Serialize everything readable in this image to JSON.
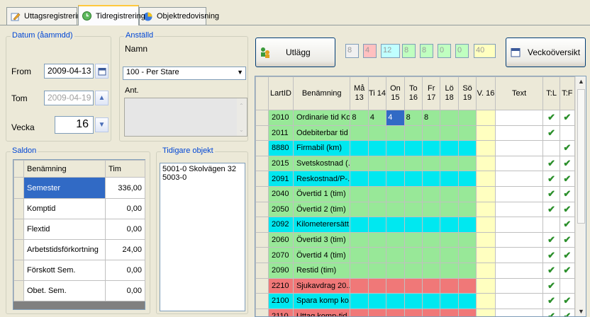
{
  "tabs": [
    {
      "label": "Uttagsregistrering",
      "icon": "pencil-icon"
    },
    {
      "label": "Tidregistrering",
      "icon": "clock-icon"
    },
    {
      "label": "Objektredovisning",
      "icon": "pie-chart-icon"
    }
  ],
  "datum": {
    "legend": "Datum (åammdd)",
    "from_label": "From",
    "from_value": "2009-04-13",
    "tom_label": "Tom",
    "tom_value": "2009-04-19",
    "vecka_label": "Vecka",
    "vecka_value": "16"
  },
  "anstalld": {
    "legend": "Anställd",
    "namn_label": "Namn",
    "namn_value": "100 - Per Stare",
    "ant_label": "Ant."
  },
  "saldon": {
    "legend": "Saldon",
    "headers": [
      "Benämning",
      "Tim"
    ],
    "rows": [
      {
        "name": "Semester",
        "value": "336,00"
      },
      {
        "name": "Komptid",
        "value": "0,00"
      },
      {
        "name": "Flextid",
        "value": "0,00"
      },
      {
        "name": "Arbetstidsförkortning",
        "value": "24,00"
      },
      {
        "name": "Förskott Sem.",
        "value": "0,00"
      },
      {
        "name": "Obet. Sem.",
        "value": "0,00"
      }
    ]
  },
  "tidigare": {
    "legend": "Tidigare objekt",
    "lines": [
      "5001-0  Skolvägen 32",
      "5003-0"
    ]
  },
  "toolbar": {
    "utlagg_label": "Utlägg",
    "totals": [
      "8",
      "4",
      "12",
      "8",
      "8",
      "0",
      "0",
      "40"
    ],
    "veckooversikt_label": "Veckoöversikt"
  },
  "grid": {
    "headers": [
      "LartID",
      "Benämning",
      "Må 13",
      "Ti 14",
      "On 15",
      "To 16",
      "Fr 17",
      "Lö 18",
      "Sö 19",
      "V. 16",
      "Text",
      "T:L",
      "T:F"
    ],
    "rows": [
      {
        "id": "2010",
        "name": "Ordinarie tid Ko...",
        "days": [
          "8",
          "4",
          "4",
          "8",
          "8",
          "",
          ""
        ],
        "tl": true,
        "tf": true,
        "color": "#98e898"
      },
      {
        "id": "2011",
        "name": "Odebiterbar tid ...",
        "days": [
          "",
          "",
          "",
          "",
          "",
          "",
          ""
        ],
        "tl": true,
        "tf": false,
        "color": "#98e898"
      },
      {
        "id": "8880",
        "name": "Firmabil (km)",
        "days": [
          "",
          "",
          "",
          "",
          "",
          "",
          ""
        ],
        "tl": false,
        "tf": true,
        "color": "#00e8f0"
      },
      {
        "id": "2015",
        "name": "Svetskostnad (...",
        "days": [
          "",
          "",
          "",
          "",
          "",
          "",
          ""
        ],
        "tl": true,
        "tf": true,
        "color": "#98e898"
      },
      {
        "id": "2091",
        "name": "Reskostnad/P-...",
        "days": [
          "",
          "",
          "",
          "",
          "",
          "",
          ""
        ],
        "tl": true,
        "tf": true,
        "color": "#00e8f0"
      },
      {
        "id": "2040",
        "name": "Övertid 1 (tim)",
        "days": [
          "",
          "",
          "",
          "",
          "",
          "",
          ""
        ],
        "tl": true,
        "tf": true,
        "color": "#98e898"
      },
      {
        "id": "2050",
        "name": "Övertid 2 (tim)",
        "days": [
          "",
          "",
          "",
          "",
          "",
          "",
          ""
        ],
        "tl": true,
        "tf": true,
        "color": "#98e898"
      },
      {
        "id": "2092",
        "name": "Kilometerersätt...",
        "days": [
          "",
          "",
          "",
          "",
          "",
          "",
          ""
        ],
        "tl": false,
        "tf": true,
        "color": "#00e8f0"
      },
      {
        "id": "2060",
        "name": "Övertid 3 (tim)",
        "days": [
          "",
          "",
          "",
          "",
          "",
          "",
          ""
        ],
        "tl": true,
        "tf": true,
        "color": "#98e898"
      },
      {
        "id": "2070",
        "name": "Övertid 4 (tim)",
        "days": [
          "",
          "",
          "",
          "",
          "",
          "",
          ""
        ],
        "tl": true,
        "tf": true,
        "color": "#98e898"
      },
      {
        "id": "2090",
        "name": "Restid (tim)",
        "days": [
          "",
          "",
          "",
          "",
          "",
          "",
          ""
        ],
        "tl": true,
        "tf": true,
        "color": "#98e898"
      },
      {
        "id": "2210",
        "name": "Sjukavdrag 20...",
        "days": [
          "",
          "",
          "",
          "",
          "",
          "",
          ""
        ],
        "tl": true,
        "tf": false,
        "color": "#f07878"
      },
      {
        "id": "2100",
        "name": "Spara komp ko...",
        "days": [
          "",
          "",
          "",
          "",
          "",
          "",
          ""
        ],
        "tl": true,
        "tf": true,
        "color": "#00e8f0"
      },
      {
        "id": "2110",
        "name": "Uttag komp-tid...",
        "days": [
          "",
          "",
          "",
          "",
          "",
          "",
          ""
        ],
        "tl": true,
        "tf": true,
        "color": "#f07878"
      }
    ]
  },
  "colors": {
    "accent": "#0046d5",
    "selection": "#316ac5",
    "green": "#98e898",
    "cyan": "#00e8f0",
    "red": "#f07878",
    "vecka": "#ffffc0"
  }
}
